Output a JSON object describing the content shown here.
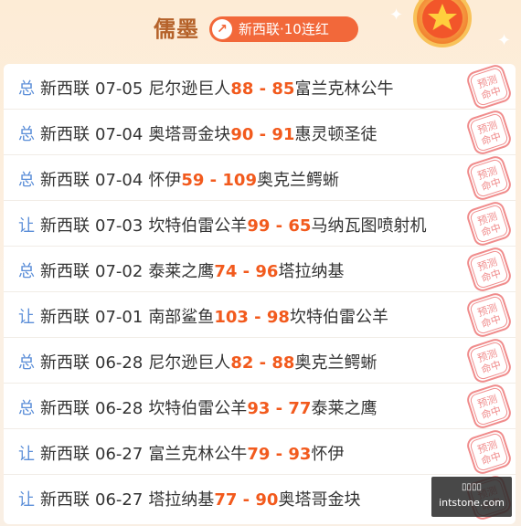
{
  "header": {
    "title": "儒墨",
    "badge_icon": "up-arrow-icon",
    "badge_text": "新西联·10连红",
    "medal_icon": "star-medal-icon"
  },
  "stamp_text": [
    "预测",
    "命中"
  ],
  "colors": {
    "accent": "#f2683a",
    "score": "#f25a1d",
    "type": "#5b8ed8",
    "stamp": "#f08c8c",
    "title": "#b5622a"
  },
  "rows": [
    {
      "type": "总",
      "league": "新西联",
      "date": "07-05",
      "home": "尼尔逊巨人",
      "home_score": "88",
      "sep": " - ",
      "away_score": "85",
      "away": "富兰克林公牛"
    },
    {
      "type": "总",
      "league": "新西联",
      "date": "07-04",
      "home": "奥塔哥金块",
      "home_score": "90",
      "sep": " - ",
      "away_score": "91",
      "away": "惠灵顿圣徒"
    },
    {
      "type": "总",
      "league": "新西联",
      "date": "07-04",
      "home": "怀伊",
      "home_score": "59",
      "sep": " - ",
      "away_score": "109",
      "away": "奥克兰鳄蜥"
    },
    {
      "type": "让",
      "league": "新西联",
      "date": "07-03",
      "home": "坎特伯雷公羊",
      "home_score": "99",
      "sep": " - ",
      "away_score": "65",
      "away": "马纳瓦图喷射机"
    },
    {
      "type": "总",
      "league": "新西联",
      "date": "07-02",
      "home": "泰莱之鹰",
      "home_score": "74",
      "sep": " - ",
      "away_score": "96",
      "away": "塔拉纳基"
    },
    {
      "type": "让",
      "league": "新西联",
      "date": "07-01",
      "home": "南部鲨鱼",
      "home_score": "103",
      "sep": " - ",
      "away_score": "98",
      "away": "坎特伯雷公羊"
    },
    {
      "type": "总",
      "league": "新西联",
      "date": "06-28",
      "home": "尼尔逊巨人",
      "home_score": "82",
      "sep": " - ",
      "away_score": "88",
      "away": "奥克兰鳄蜥"
    },
    {
      "type": "总",
      "league": "新西联",
      "date": "06-28",
      "home": "坎特伯雷公羊",
      "home_score": "93",
      "sep": " - ",
      "away_score": "77",
      "away": "泰莱之鹰"
    },
    {
      "type": "让",
      "league": "新西联",
      "date": "06-27",
      "home": "富兰克林公牛",
      "home_score": "79",
      "sep": " - ",
      "away_score": "93",
      "away": "怀伊"
    },
    {
      "type": "让",
      "league": "新西联",
      "date": "06-27",
      "home": "塔拉纳基",
      "home_score": "77",
      "sep": " - ",
      "away_score": "90",
      "away": "奥塔哥金块"
    }
  ],
  "watermark": {
    "top": "▯▯▯▯",
    "bottom": "intstone.com"
  }
}
